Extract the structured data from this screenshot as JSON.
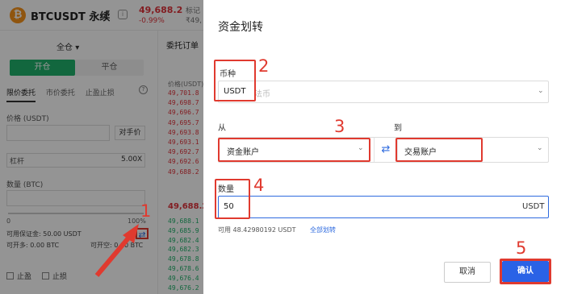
{
  "header": {
    "pair_title": "BTCUSDT 永续",
    "price": "49,688.2",
    "change_pct": "-0.99%",
    "index_label": "标记",
    "index_price": "₹49,"
  },
  "left_panel": {
    "margin_mode": "全仓",
    "open_tab": "开仓",
    "close_tab": "平仓",
    "order_tabs": [
      "限价委托",
      "市价委托",
      "止盈止损"
    ],
    "price_label": "价格 (USDT)",
    "opponent_button": "对手价",
    "leverage_label": "杠杆",
    "leverage_value": "5.00X",
    "quantity_label": "数量 (BTC)",
    "slider_min": "0",
    "slider_max": "100%",
    "available_margin": "可用保证金: 50.00 USDT",
    "can_long": "可开多: 0.00 BTC",
    "can_short": "可开空: 0.00 BTC",
    "take_profit": "止盈",
    "stop_loss": "止损"
  },
  "order_book": {
    "title": "委托订单",
    "header": "价格(USDT)",
    "asks": [
      "49,701.8",
      "49,698.7",
      "49,696.7",
      "49,695.7",
      "49,693.8",
      "49,693.1",
      "49,692.7",
      "49,692.6",
      "49,688.2"
    ],
    "mid": "49,688.2",
    "bids": [
      "49,688.1",
      "49,685.9",
      "49,682.4",
      "49,682.3",
      "49,678.8",
      "49,678.6",
      "49,676.4",
      "49,676.2"
    ]
  },
  "modal": {
    "title": "资金划转",
    "currency_label": "币种",
    "currency_value": "USDT",
    "currency_placeholder": "法币",
    "from_label": "从",
    "to_label": "到",
    "from_value": "资金账户",
    "to_value": "交易账户",
    "swap_icon": "swap-arrows-icon",
    "quantity_label": "数量",
    "quantity_value": "50",
    "quantity_unit": "USDT",
    "available_label": "可用",
    "available_value": "48.42980192 USDT",
    "transfer_all": "全部划转",
    "cancel_button": "取消",
    "confirm_button": "确认"
  },
  "annotations": {
    "step1": "1",
    "step2": "2",
    "step3": "3",
    "step4": "4",
    "step5": "5",
    "color": "#e03a2f"
  },
  "colors": {
    "accent": "#2a62e6",
    "buy": "#20b26c",
    "sell": "#e0333b"
  }
}
